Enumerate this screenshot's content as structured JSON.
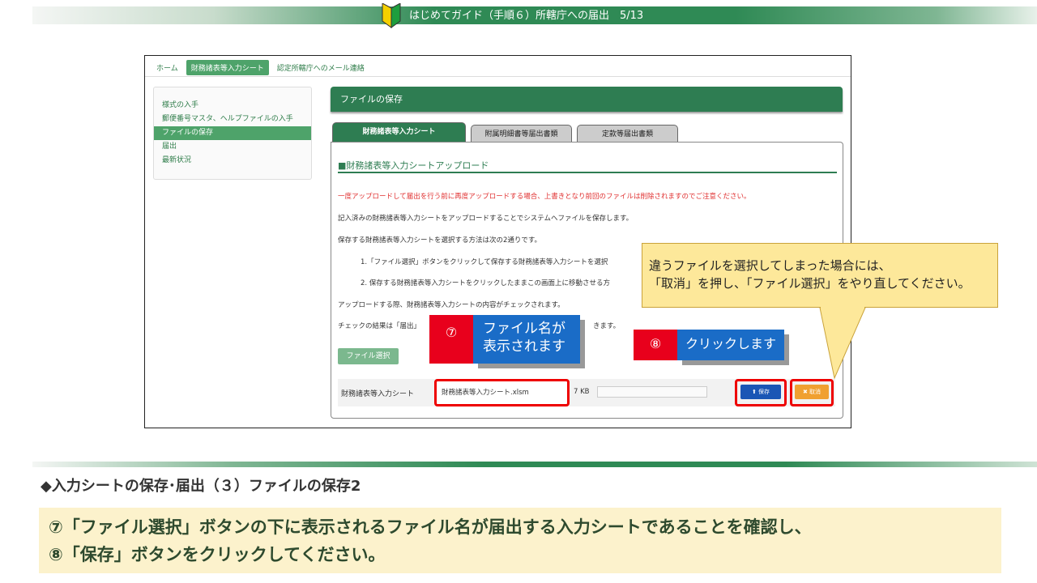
{
  "header": {
    "title": "はじめてガイド（手順６）所轄庁への届出　5/13",
    "colors": {
      "band": "#2f8a55"
    }
  },
  "nav": {
    "home": "ホーム",
    "input_sheet": "財務諸表等入力シート",
    "mail": "認定所轄庁へのメール連絡"
  },
  "sidebar": {
    "items": [
      {
        "label": "様式の入手"
      },
      {
        "label": "郵便番号マスタ、ヘルプファイルの入手"
      },
      {
        "label": "ファイルの保存"
      },
      {
        "label": "届出"
      },
      {
        "label": "最新状況"
      }
    ]
  },
  "main": {
    "header": "ファイルの保存",
    "tabs": [
      {
        "label": "財務諸表等入力シート"
      },
      {
        "label": "附属明細書等届出書類"
      },
      {
        "label": "定款等届出書類"
      }
    ],
    "section_title": "■財務諸表等入力シートアップロード",
    "lines": {
      "warning": "一度アップロードして届出を行う前に再度アップロードする場合、上書きとなり前回のファイルは削除されますのでご注意ください。",
      "l1": "記入済みの財務諸表等入力シートをアップロードすることでシステムへファイルを保存します。",
      "l2": "保存する財務諸表等入力シートを選択する方法は次の2通りです。",
      "l3": "1.「ファイル選択」ボタンをクリックして保存する財務諸表等入力シートを選択",
      "l4": "2. 保存する財務諸表等入力シートをクリックしたままこの画面上に移動させる方",
      "l5": "アップロードする際、財務諸表等入力シートの内容がチェックされます。",
      "l6a": "チェックの結果は「届出」",
      "l6b": "きます。"
    },
    "file_select_button": "ファイル選択",
    "row": {
      "label": "財務諸表等入力シート",
      "file_name": "財務諸表等入力シート.xlsm",
      "size": "7 KB",
      "save_button": "保存",
      "cancel_button": "取消"
    }
  },
  "callouts": {
    "c7": {
      "num": "⑦",
      "line1": "ファイル名が",
      "line2": "表示されます"
    },
    "c8": {
      "num": "⑧",
      "text": "クリックします"
    },
    "tip": {
      "line1": "違うファイルを選択してしまった場合には、",
      "line2": "「取消」を押し、「ファイル選択」をやり直してください。"
    }
  },
  "bottom": {
    "subtitle": "◆入力シートの保存･届出（３）ファイルの保存2",
    "line1": "⑦「ファイル選択」ボタンの下に表示されるファイル名が届出する入力シートであることを確認し、",
    "line2": "⑧「保存」ボタンをクリックしてください。"
  }
}
